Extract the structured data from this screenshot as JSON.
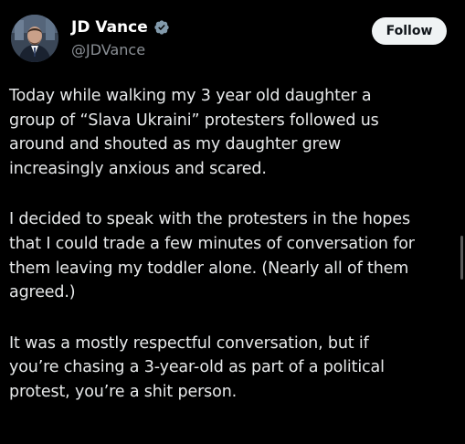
{
  "author": {
    "display_name": "JD Vance",
    "handle": "@JDVance",
    "verified": true
  },
  "follow_button": {
    "label": "Follow"
  },
  "tweet": {
    "paragraphs": [
      "Today while walking my 3 year old daughter a\ngroup of “Slava Ukraini” protesters followed us\naround and shouted as my daughter grew\nincreasingly anxious and scared.",
      "I decided to speak with the protesters in the hopes\nthat I could trade a few minutes of conversation for\nthem leaving my toddler alone. (Nearly all of them\nagreed.)",
      "It was a mostly respectful conversation,  but if\nyou’re chasing a 3-year-old as part of a political\nprotest, you’re a shit person."
    ]
  },
  "colors": {
    "background": "#000000",
    "text": "#e7e9ea",
    "handle": "#8a8f95",
    "verified_badge": "#829aab",
    "button_bg": "#eff3f4",
    "button_text": "#0f1419"
  },
  "icons": {
    "verified": "verified-badge-icon"
  }
}
